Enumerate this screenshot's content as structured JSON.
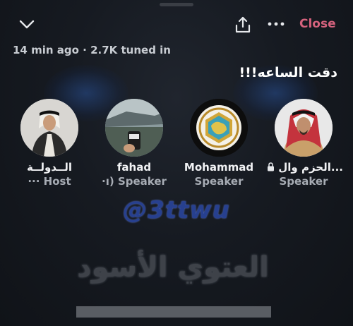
{
  "header": {
    "close_label": "Close",
    "meta": "14 min ago · 2.7K tuned in"
  },
  "room": {
    "title": "دقت الساعه!!!"
  },
  "participants": [
    {
      "name": "الــدولــة",
      "role": "··· Host"
    },
    {
      "name": "fahad",
      "role": "·ı) Speaker"
    },
    {
      "name": "Mohammad",
      "role": "Speaker"
    },
    {
      "name": "الحزم وال...",
      "role": "Speaker"
    }
  ],
  "overlay": {
    "handle": "@3ttwu",
    "arabic": "العتوي الأسود"
  },
  "colors": {
    "close": "#d5627d",
    "background": "#161a21"
  },
  "icons": {
    "collapse": "chevron-down-icon",
    "share": "share-icon",
    "more": "more-icon",
    "lock": "lock-icon"
  }
}
